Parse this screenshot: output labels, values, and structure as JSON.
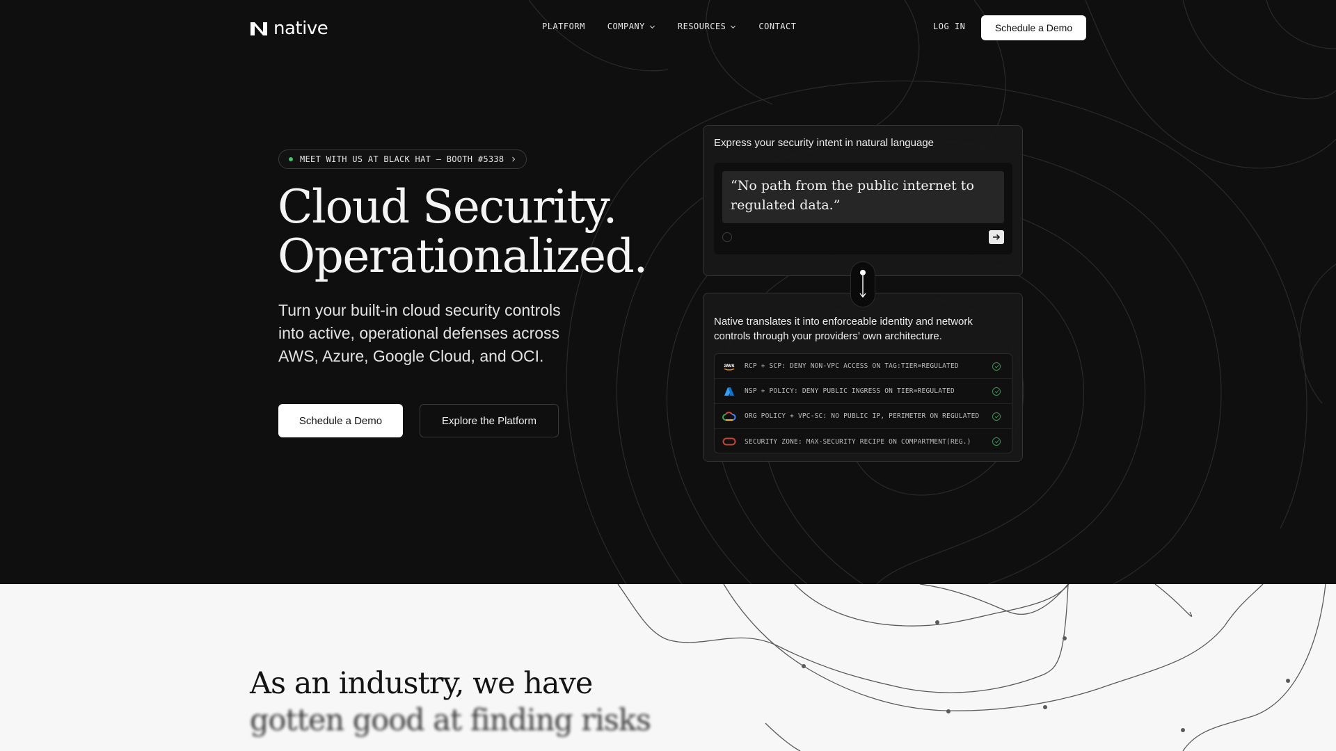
{
  "nav": {
    "logo_text": "native",
    "links": [
      {
        "label": "PLATFORM"
      },
      {
        "label": "COMPANY"
      },
      {
        "label": "RESOURCES"
      },
      {
        "label": "CONTACT"
      }
    ],
    "login": "LOG IN",
    "cta": "Schedule a Demo"
  },
  "hero": {
    "pill": "MEET WITH US AT BLACK HAT – BOOTH #5338",
    "title_line1": "Cloud Security.",
    "title_line2": "Operationalized.",
    "subtitle": "Turn your built-in cloud security controls into active, operational defenses across AWS, Azure, Google Cloud, and OCI.",
    "primary_button": "Schedule a Demo",
    "secondary_button": "Explore the Platform"
  },
  "panel": {
    "intent_label": "Express your security intent in natural language",
    "intent_quote": "“No path from the public internet to regulated data.”",
    "translate_label": "Native translates it into enforceable identity and network controls through your providers’ own architecture.",
    "rules": [
      {
        "provider": "aws",
        "logo_text": "aws",
        "text": "RCP + SCP: DENY NON-VPC ACCESS ON TAG:TIER=REGULATED"
      },
      {
        "provider": "azure",
        "logo_text": "",
        "text": "NSP + POLICY: DENY PUBLIC INGRESS ON TIER=REGULATED"
      },
      {
        "provider": "gcp",
        "logo_text": "",
        "text": "ORG POLICY + VPC-SC: NO PUBLIC IP, PERIMETER ON REGULATED"
      },
      {
        "provider": "oci",
        "logo_text": "",
        "text": "SECURITY ZONE: MAX-SECURITY RECIPE ON COMPARTMENT(REG.)"
      }
    ]
  },
  "lower": {
    "line1": "As an industry, we have",
    "line2": "gotten good at finding risks"
  },
  "colors": {
    "hero_bg": "#0f0f0f",
    "lower_bg": "#f7f7f7",
    "status_green": "#3ec46d",
    "aws_orange": "#ff9900",
    "azure_blue": "#0078d4",
    "oci_red": "#c74634"
  }
}
